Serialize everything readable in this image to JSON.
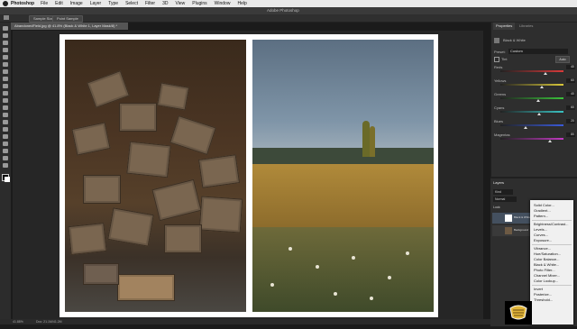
{
  "menubar": {
    "app_name": "Photoshop",
    "items": [
      "File",
      "Edit",
      "Image",
      "Layer",
      "Type",
      "Select",
      "Filter",
      "3D",
      "View",
      "Plugins",
      "Window",
      "Help"
    ]
  },
  "window": {
    "title": "Adobe Photoshop"
  },
  "options_bar": {
    "btn1": "Sample Size",
    "btn2": "Point Sample"
  },
  "document_tab": {
    "label": "AbandonedField.jpg @ 41.8% (Black & White 1, Layer Mask/8) *"
  },
  "status_bar": {
    "zoom": "41.88%",
    "doc_info": "Doc: 21.1M/41.2M"
  },
  "properties": {
    "tab_properties": "Properties",
    "tab_libraries": "Libraries",
    "adjustment_name": "Black & White",
    "preset_label": "Preset:",
    "preset_value": "Custom",
    "tint_label": "Tint",
    "auto_label": "Auto",
    "sliders": [
      {
        "label": "Reds",
        "value": "40",
        "color": "#d93a3a",
        "pos": 0.72
      },
      {
        "label": "Yellows",
        "value": "60",
        "color": "#d9c83a",
        "pos": 0.66
      },
      {
        "label": "Greens",
        "value": "40",
        "color": "#3ac23a",
        "pos": 0.6
      },
      {
        "label": "Cyans",
        "value": "60",
        "color": "#3ac2c2",
        "pos": 0.62
      },
      {
        "label": "Blues",
        "value": "20",
        "color": "#3a5ad9",
        "pos": 0.4
      },
      {
        "label": "Magentas",
        "value": "80",
        "color": "#c23ac2",
        "pos": 0.78
      }
    ]
  },
  "layers": {
    "tab": "Layers",
    "kind_label": "Kind",
    "mode": "Normal",
    "opacity_label": "Opacity:",
    "opacity_value": "100%",
    "lock_label": "Lock:",
    "fill_label": "Fill:",
    "layer_names": [
      "Black & White 1",
      "Background"
    ]
  },
  "adjustment_menu": {
    "items": [
      "Solid Color...",
      "Gradient...",
      "Pattern...",
      "Brightness/Contrast...",
      "Levels...",
      "Curves...",
      "Exposure...",
      "Vibrance...",
      "Hue/Saturation...",
      "Color Balance...",
      "Black & White...",
      "Photo Filter...",
      "Channel Mixer...",
      "Color Lookup...",
      "Invert",
      "Posterize...",
      "Threshold..."
    ]
  },
  "colors": {
    "menubar_bg": "#e9e9e9",
    "panel_bg": "#2e2e2e",
    "canvas_bg": "#262626"
  },
  "icons": [
    "apple-icon",
    "move-tool-icon",
    "marquee-tool-icon",
    "lasso-tool-icon",
    "brush-tool-icon",
    "eyedropper-icon",
    "logo-icon"
  ]
}
